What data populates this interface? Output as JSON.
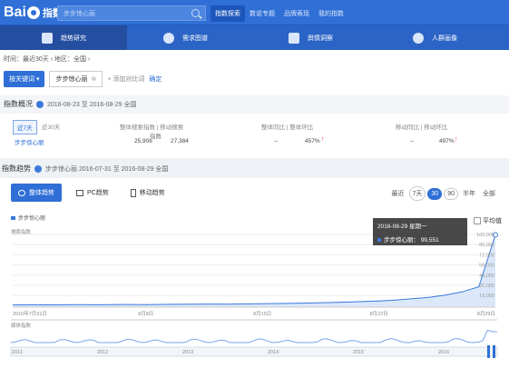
{
  "header": {
    "logo_text": "Bai",
    "logo_suffix": "指数",
    "search_placeholder": "步步惊心丽",
    "nav": [
      "指数探索",
      "数说专题",
      "品牌表现",
      "我的指数"
    ],
    "nav_active": 0
  },
  "subnav": [
    "趋势研究",
    "需求图谱",
    "舆情洞察",
    "人群画像"
  ],
  "breadcrumb": "时间：最近30天 ›   地区：全国 ›",
  "keywords": {
    "button": "按关键词 ▾",
    "chip": "步步惊心丽",
    "chip_close": "⊗",
    "add": "+ 添加对比词",
    "confirm": "确定"
  },
  "overview": {
    "title": "指数概况",
    "dates": "2016-08-23 至 2016-08-29   全国",
    "periods": [
      "近7天",
      "近30天"
    ],
    "columns": [
      "整体搜索指数 | 移动搜索",
      "整体同比 | 整体环比",
      "移动同比 | 移动环比"
    ],
    "subheader": "指数",
    "row": {
      "keyword": "步步惊心丽",
      "overall": "25,906",
      "mobile": "27,384",
      "yoy": "--",
      "mom": "457%",
      "m_yoy": "--",
      "m_mom": "497%"
    }
  },
  "trend": {
    "title": "指数趋势",
    "meta": "步步惊心丽   2016-07-31 至 2016-08-29   全国",
    "tabs": [
      "整体趋势",
      "PC趋势",
      "移动趋势"
    ],
    "range_label": "最近",
    "ranges": [
      "7天",
      "30",
      "90",
      "半年",
      "全部"
    ],
    "range_active": 2
  },
  "tooltip": {
    "date": "2016-08-29 星期一",
    "series": "步步惊心丽：",
    "value": "99,551"
  },
  "avg_label": "平均值",
  "legend": "步步惊心丽",
  "axis_title": "搜索指数",
  "brush_title": "媒体指数",
  "chart_data": {
    "type": "line",
    "series": [
      {
        "name": "步步惊心丽",
        "values": [
          3000,
          3200,
          3100,
          3300,
          3400,
          3300,
          3500,
          3600,
          3500,
          3700,
          3900,
          4000,
          4200,
          4100,
          4400,
          4700,
          5000,
          5400,
          5800,
          6200,
          6900,
          7600,
          8500,
          9800,
          11500,
          13500,
          16500,
          21000,
          28000,
          99551
        ]
      }
    ],
    "x_ticks": [
      "2016年7月31日",
      "8月8日",
      "8月15日",
      "8月22日",
      "8月29日"
    ],
    "y_ticks": [
      "100,000",
      "86,000",
      "72,000",
      "58,000",
      "44,000",
      "30,000",
      "16,000"
    ],
    "brush_years": [
      "2011",
      "2012",
      "2013",
      "2014",
      "2015",
      "2016"
    ],
    "colors": {
      "line": "#3a78db",
      "fill": "#dbe8fa"
    }
  }
}
